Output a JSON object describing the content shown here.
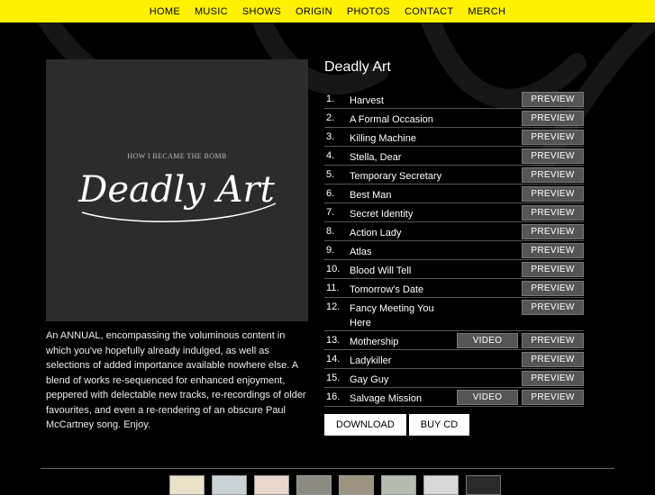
{
  "nav": [
    "HOME",
    "MUSIC",
    "SHOWS",
    "ORIGIN",
    "PHOTOS",
    "CONTACT",
    "MERCH"
  ],
  "album": {
    "title": "Deadly Art",
    "cover_band": "HOW I BECAME THE BOMB",
    "cover_title": "Deadly Art",
    "description": "An ANNUAL, encompassing the voluminous content in which you've hopefully already indulged, as well as selections of added importance available nowhere else. A blend of works re-sequenced for enhanced enjoyment, peppered with delectable new tracks, re-recordings of older favourites, and even a re-rendering of an obscure Paul McCartney song. Enjoy."
  },
  "buttons": {
    "preview": "PREVIEW",
    "video": "VIDEO",
    "download": "DOWNLOAD",
    "buy_cd": "BUY CD"
  },
  "tracks": [
    {
      "num": "1.",
      "name": "Harvest",
      "video": false
    },
    {
      "num": "2.",
      "name": "A Formal Occasion",
      "video": false
    },
    {
      "num": "3.",
      "name": "Killing Machine",
      "video": false
    },
    {
      "num": "4.",
      "name": "Stella, Dear",
      "video": false
    },
    {
      "num": "5.",
      "name": "Temporary Secretary",
      "video": false
    },
    {
      "num": "6.",
      "name": "Best Man",
      "video": false
    },
    {
      "num": "7.",
      "name": "Secret Identity",
      "video": false
    },
    {
      "num": "8.",
      "name": "Action Lady",
      "video": false
    },
    {
      "num": "9.",
      "name": "Atlas",
      "video": false
    },
    {
      "num": "10.",
      "name": "Blood Will Tell",
      "video": false
    },
    {
      "num": "11.",
      "name": "Tomorrow's Date",
      "video": false
    },
    {
      "num": "12.",
      "name": "Fancy Meeting You Here",
      "video": false
    },
    {
      "num": "13.",
      "name": "Mothership",
      "video": true
    },
    {
      "num": "14.",
      "name": "Ladykiller",
      "video": false
    },
    {
      "num": "15.",
      "name": "Gay Guy",
      "video": false
    },
    {
      "num": "16.",
      "name": "Salvage Mission",
      "video": true
    }
  ],
  "thumbnail_colors": [
    "#e9e1c8",
    "#c9d3d6",
    "#e8d6cf",
    "#8a8a80",
    "#9a9480",
    "#b6bcb0",
    "#d8d8d8",
    "#2a2a2a"
  ],
  "colors": {
    "nav_bg": "#fff200",
    "cover_bg": "#2c2c2c",
    "button_bg": "#555555"
  }
}
